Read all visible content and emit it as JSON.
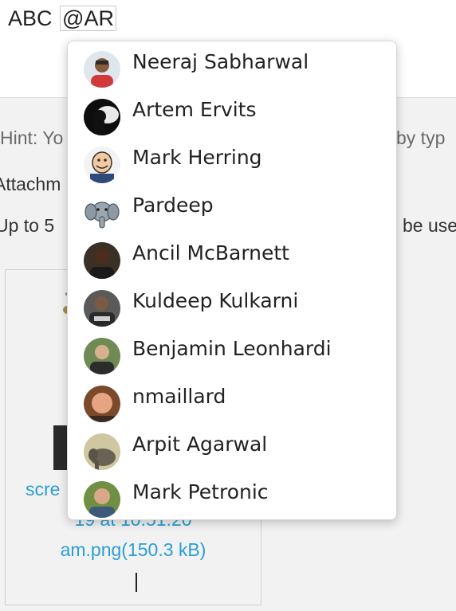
{
  "editor": {
    "prefix_text": "ABC",
    "mention_text": "@AR"
  },
  "panel": {
    "hint_left": "Hint: Yo",
    "hint_right": "by typ",
    "attachments_label": "Attachm",
    "upto_left": "Up to 5",
    "upto_right": "be use",
    "attachment": {
      "line1": "scre",
      "line2": "19 at 10.51.20",
      "line3": "am.png(150.3 kB)"
    }
  },
  "mention_suggestions": [
    {
      "name": "Neeraj Sabharwal",
      "avatar": "person-avatar"
    },
    {
      "name": "Artem Ervits",
      "avatar": "silhouette-avatar"
    },
    {
      "name": "Mark Herring",
      "avatar": "cartoon-avatar"
    },
    {
      "name": "Pardeep",
      "avatar": "elephant-avatar"
    },
    {
      "name": "Ancil McBarnett",
      "avatar": "person-avatar"
    },
    {
      "name": "Kuldeep Kulkarni",
      "avatar": "person-avatar"
    },
    {
      "name": "Benjamin Leonhardi",
      "avatar": "person-avatar"
    },
    {
      "name": "nmaillard",
      "avatar": "person-avatar"
    },
    {
      "name": "Arpit Agarwal",
      "avatar": "elephant-avatar"
    },
    {
      "name": "Mark Petronic",
      "avatar": "person-avatar"
    }
  ],
  "colors": {
    "link": "#2a9fd6",
    "panel_bg": "#f2f2f2"
  }
}
